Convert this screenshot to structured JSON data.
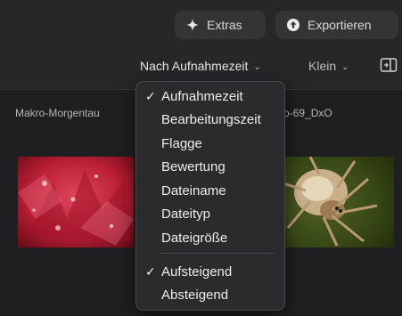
{
  "toolbar": {
    "extras_label": "Extras",
    "export_label": "Exportieren"
  },
  "view_controls": {
    "sort_label": "Nach Aufnahmezeit",
    "size_label": "Klein"
  },
  "thumbnails": [
    {
      "label": "Makro-Morgentau"
    },
    {
      "label": "o-69_DxO"
    }
  ],
  "sort_menu": {
    "sort_fields": [
      {
        "label": "Aufnahmezeit",
        "checked": true
      },
      {
        "label": "Bearbeitungszeit",
        "checked": false
      },
      {
        "label": "Flagge",
        "checked": false
      },
      {
        "label": "Bewertung",
        "checked": false
      },
      {
        "label": "Dateiname",
        "checked": false
      },
      {
        "label": "Dateityp",
        "checked": false
      },
      {
        "label": "Dateigröße",
        "checked": false
      }
    ],
    "sort_order": [
      {
        "label": "Aufsteigend",
        "checked": true
      },
      {
        "label": "Absteigend",
        "checked": false
      }
    ],
    "check_glyph": "✓"
  },
  "colors": {
    "background": "#1f1f21",
    "toolbar_bg": "#272729",
    "button_bg": "#343437",
    "menu_bg": "#2b2b2d",
    "menu_border": "#4b4b4f"
  }
}
